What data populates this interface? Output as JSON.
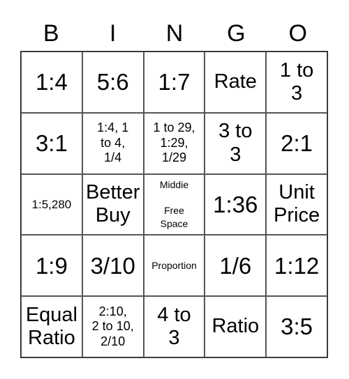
{
  "header": [
    "B",
    "I",
    "N",
    "G",
    "O"
  ],
  "cells": [
    "1:4",
    "5:6",
    "1:7",
    "Rate",
    "1 to\n3",
    "3:1",
    "1:4, 1\nto 4,\n1/4",
    "1 to 29,\n1:29,\n1/29",
    "3 to\n3",
    "2:1",
    "1:5,280",
    "Better\nBuy",
    "Middie\n\nFree\nSpace",
    "1:36",
    "Unit\nPrice",
    "1:9",
    "3/10",
    "Proportion",
    "1/6",
    "1:12",
    "Equal\nRatio",
    "2:10,\n2 to 10,\n2/10",
    "4 to\n3",
    "Ratio",
    "3:5"
  ]
}
